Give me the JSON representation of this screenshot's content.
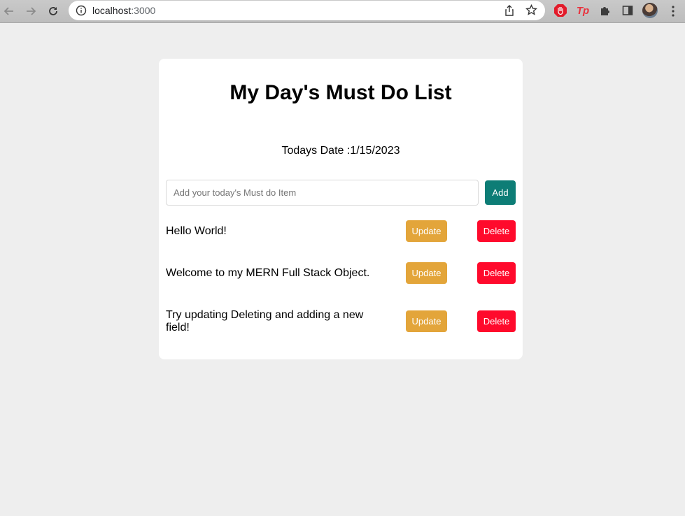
{
  "browser": {
    "url_host": "localhost",
    "url_port": ":3000"
  },
  "app": {
    "title": "My Day's Must Do List",
    "date_label": "Todays Date :",
    "date_value": "1/15/2023",
    "input_placeholder": "Add your today's Must do Item",
    "add_label": "Add",
    "items": [
      {
        "text": "Hello World!",
        "update_label": "Update",
        "delete_label": "Delete"
      },
      {
        "text": "Welcome to my MERN Full Stack Object.",
        "update_label": "Update",
        "delete_label": "Delete"
      },
      {
        "text": "Try updating Deleting and adding a new field!",
        "update_label": "Update",
        "delete_label": "Delete"
      }
    ]
  },
  "colors": {
    "add_button": "#0d7d76",
    "update_button": "#e3a53a",
    "delete_button": "#ff0a2c",
    "page_background": "#eeeeee"
  }
}
